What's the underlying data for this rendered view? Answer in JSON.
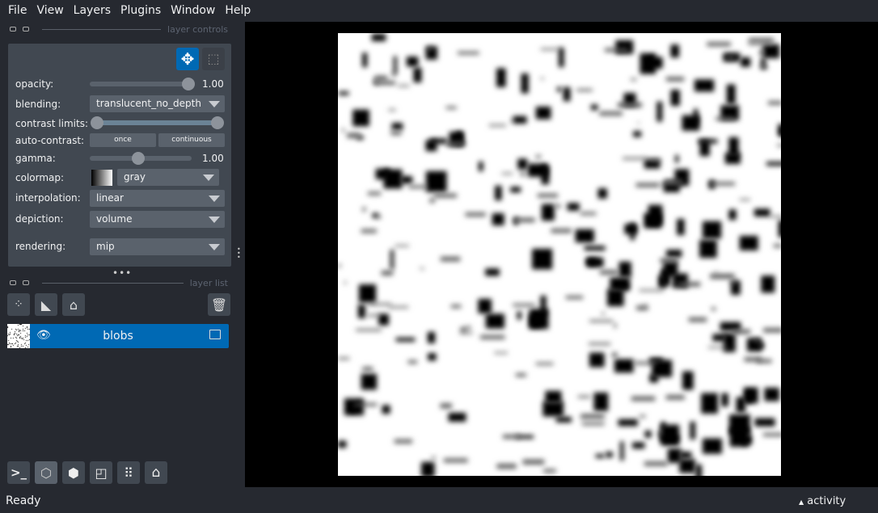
{
  "menu": [
    "File",
    "View",
    "Layers",
    "Plugins",
    "Window",
    "Help"
  ],
  "layer_controls": {
    "header": "layer controls",
    "opacity": {
      "label": "opacity:",
      "value": "1.00",
      "fraction": 1.0
    },
    "blending": {
      "label": "blending:",
      "value": "translucent_no_depth"
    },
    "contrast_limits": {
      "label": "contrast limits:",
      "range": [
        0,
        1
      ]
    },
    "auto_contrast": {
      "label": "auto-contrast:",
      "once": "once",
      "continuous": "continuous"
    },
    "gamma": {
      "label": "gamma:",
      "value": "1.00",
      "fraction": 0.5
    },
    "colormap": {
      "label": "colormap:",
      "value": "gray"
    },
    "interpolation": {
      "label": "interpolation:",
      "value": "linear"
    },
    "depiction": {
      "label": "depiction:",
      "value": "volume"
    },
    "rendering": {
      "label": "rendering:",
      "value": "mip"
    },
    "accent": "#0069b4"
  },
  "layer_list": {
    "header": "layer list",
    "layers": [
      {
        "name": "blobs",
        "visible": true,
        "selected": true
      }
    ]
  },
  "status": {
    "text": "Ready",
    "activity": "activity"
  }
}
